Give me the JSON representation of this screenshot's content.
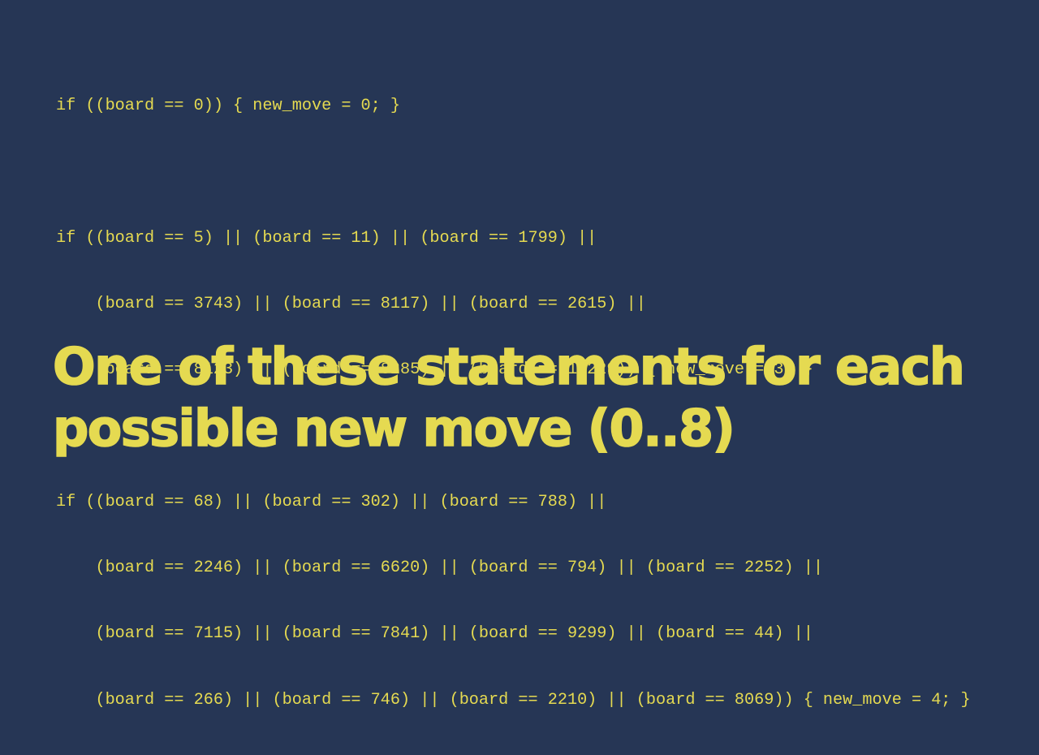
{
  "slide": {
    "background_color": "#263655",
    "text_color": "#e5da51",
    "code_lines": [
      "if ((board == 0)) { new_move = 0; }",
      "",
      "if ((board == 5) || (board == 11) || (board == 1799) ||",
      "    (board == 3743) || (board == 8117) || (board == 2615) ||",
      "    (board == 8123) || (board == 8285) || (board == 10229)) { new_move = 3; }",
      "",
      "if ((board == 68) || (board == 302) || (board == 788) ||",
      "    (board == 2246) || (board == 6620) || (board == 794) || (board == 2252) ||",
      "    (board == 7115) || (board == 7841) || (board == 9299) || (board == 44) ||",
      "    (board == 266) || (board == 746) || (board == 2210) || (board == 8069)) { new_move = 4; }"
    ],
    "headline_lines": [
      "One of these statements for each",
      "possible new move (0..8)"
    ]
  }
}
